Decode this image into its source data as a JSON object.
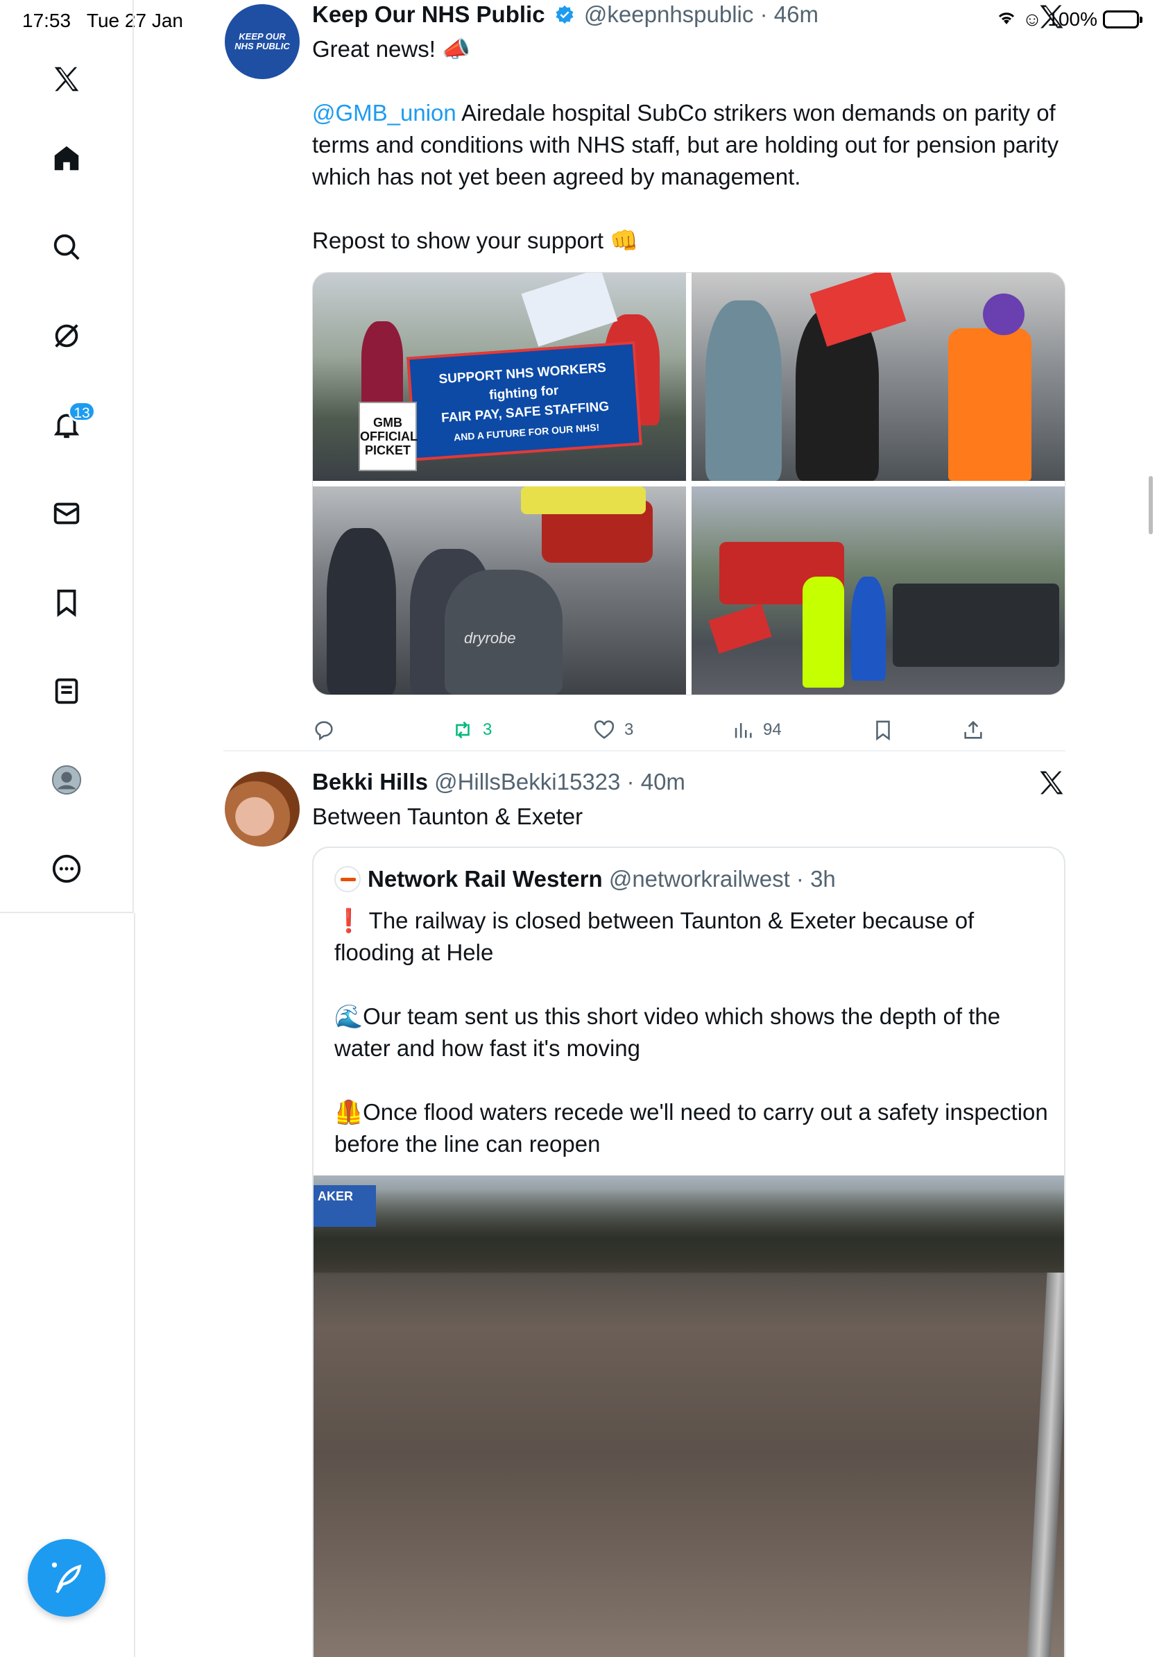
{
  "status_bar": {
    "time": "17:53",
    "date": "Tue 27 Jan",
    "battery": "100%"
  },
  "sidebar": {
    "notifications_badge": "13",
    "items": [
      "x-logo",
      "home",
      "search",
      "grok",
      "notifications",
      "messages",
      "bookmarks",
      "lists",
      "profile",
      "more"
    ]
  },
  "posts": [
    {
      "author_name": "Keep Our NHS Public",
      "handle": "@keepnhspublic",
      "time": "46m",
      "avatar_text_1": "KEEP OUR",
      "avatar_text_2": "NHS PUBLIC",
      "line1": "Great news! 📣",
      "mention": "@GMB_union",
      "line2": " Airedale hospital SubCo strikers won demands on parity of terms and conditions with NHS staff, but are holding out for pension parity which has not yet been agreed by management.",
      "line3": "Repost to show your support 👊",
      "image_banner_1": "SUPPORT NHS WORKERS",
      "image_banner_2": "fighting for",
      "image_banner_3": "FAIR PAY, SAFE STAFFING",
      "image_banner_4": "AND A FUTURE FOR OUR NHS!",
      "image_picket": "GMB OFFICIAL PICKET",
      "image_hoodie": "dryrobe",
      "reposts": "3",
      "likes": "3",
      "views": "94"
    },
    {
      "author_name": "Bekki Hills",
      "handle": "@HillsBekki15323",
      "time": "40m",
      "text": "Between Taunton & Exeter",
      "quote": {
        "author_name": "Network Rail Western",
        "handle": "@networkrailwest",
        "time": "3h",
        "para1": "❗ The railway is closed between Taunton & Exeter because of flooding at Hele",
        "para2": "🌊Our team sent us this short video which shows the depth of the water and how fast it's moving",
        "para3": "🦺Once flood waters recede we'll need to carry out a safety inspection before the line can reopen",
        "video_sign": "AKER"
      }
    }
  ],
  "colors": {
    "accent": "#1d9bf0",
    "repost_green": "#00ba7c",
    "text_primary": "#0f1419",
    "text_secondary": "#536471"
  }
}
